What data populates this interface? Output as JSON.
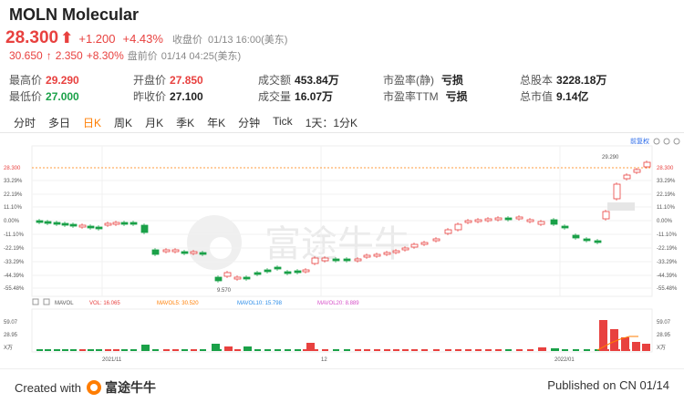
{
  "header": {
    "title": "MOLN Molecular",
    "price": "28.300",
    "change": "+1.200",
    "change_pct": "+4.43%",
    "close_label": "收盘价",
    "close_time": "01/13 16:00(美东)",
    "pre_price": "30.650",
    "pre_change": "2.350",
    "pre_pct": "+8.30%",
    "pre_label": "盘前价",
    "pre_time": "01/14 04:25(美东)"
  },
  "stats": {
    "high_label": "最高价",
    "high": "29.290",
    "low_label": "最低价",
    "low": "27.000",
    "open_label": "开盘价",
    "open": "27.850",
    "prev_close_label": "昨收价",
    "prev_close": "27.100",
    "turnover_label": "成交额",
    "turnover": "453.84万",
    "volume_label": "成交量",
    "volume": "16.07万",
    "pe_static_label": "市盈率(静)",
    "pe_static": "亏损",
    "pe_ttm_label": "市盈率TTM",
    "pe_ttm": "亏损",
    "total_shares_label": "总股本",
    "total_shares": "3228.18万",
    "market_cap_label": "总市值",
    "market_cap": "9.14亿"
  },
  "tabs": [
    "分时",
    "多日",
    "日K",
    "周K",
    "月K",
    "季K",
    "年K",
    "分钟",
    "Tick",
    "1天：1分K"
  ],
  "active_tab": "日K",
  "chart_top": {
    "adjust_label": "前复权",
    "right_ticks": [
      "28.300",
      "33.29%",
      "22.19%",
      "11.10%",
      "0.00%",
      "-11.10%",
      "-22.19%",
      "-33.29%",
      "-44.39%",
      "-55.48%"
    ],
    "left_ticks": [
      "28.300",
      "33.29%",
      "22.19%",
      "11.10%",
      "0.00%",
      "-11.10%",
      "-22.19%",
      "-33.29%",
      "-44.39%",
      "-55.48%"
    ],
    "high_marker": "29.290",
    "low_marker": "9.570",
    "watermark": "富途牛牛"
  },
  "volume_legend": {
    "mavol": "MAVOL",
    "vol": "VOL: 16.065",
    "mavol5": "MAVOL5: 30.520",
    "mavol10": "MAVOL10: 15.798",
    "mavol20": "MAVOL20: 8.889",
    "y_ticks_left": [
      "59.07",
      "28.95",
      "X万"
    ],
    "y_ticks_right": [
      "59.07",
      "28.95",
      "X万"
    ]
  },
  "x_labels": [
    "2021/11",
    "12",
    "2022/01"
  ],
  "footer": {
    "created_with": "Created with",
    "brand": "富途牛牛",
    "published": "Published on CN 01/14"
  },
  "colors": {
    "up": "#e8413f",
    "down": "#1aa148",
    "accent": "#ff7d00"
  }
}
